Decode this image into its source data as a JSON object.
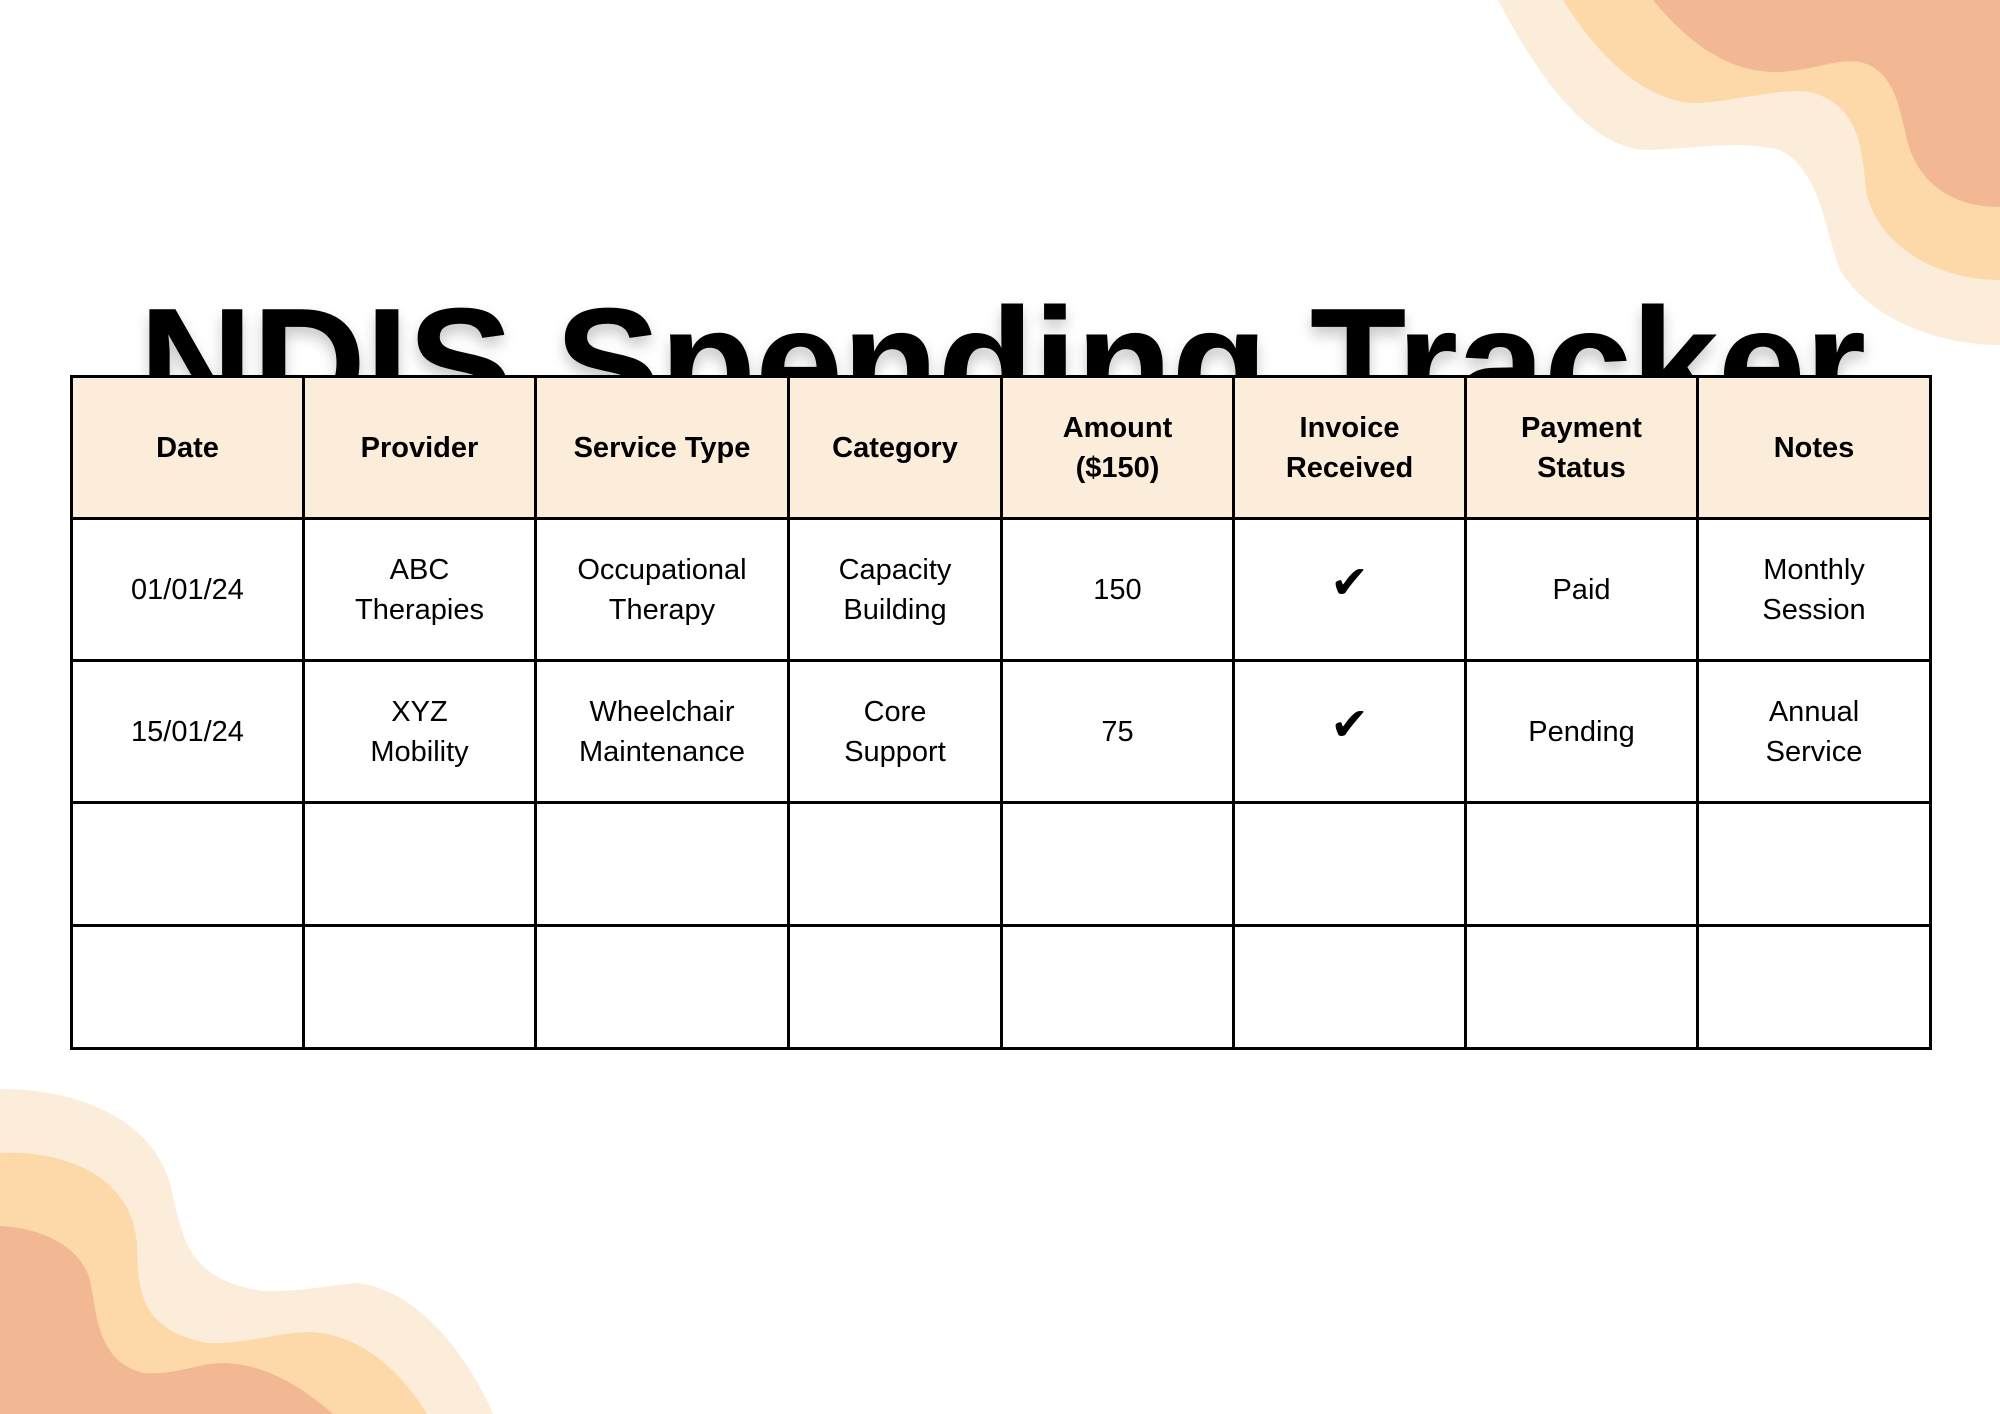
{
  "title": "NDIS Spending Tracker",
  "colors": {
    "header_bg": "#FCEDDB",
    "wave_light": "#FCEDDB",
    "wave_mid": "#FDD8A8",
    "wave_dark": "#F2B894",
    "border": "#000000"
  },
  "table": {
    "headers": [
      {
        "lines": [
          "Date"
        ]
      },
      {
        "lines": [
          "Provider"
        ]
      },
      {
        "lines": [
          "Service Type"
        ]
      },
      {
        "lines": [
          "Category"
        ]
      },
      {
        "lines": [
          "Amount",
          "($150)"
        ]
      },
      {
        "lines": [
          "Invoice",
          "Received"
        ]
      },
      {
        "lines": [
          "Payment",
          "Status"
        ]
      },
      {
        "lines": [
          "Notes"
        ]
      }
    ],
    "rows": [
      {
        "date": "01/01/24",
        "provider": [
          "ABC",
          "Therapies"
        ],
        "service_type": [
          "Occupational",
          "Therapy"
        ],
        "category": [
          "Capacity",
          "Building"
        ],
        "amount": "150",
        "invoice_received": "check-icon",
        "invoice_glyph": "✔",
        "payment_status": "Paid",
        "notes": [
          "Monthly",
          "Session"
        ]
      },
      {
        "date": "15/01/24",
        "provider": [
          "XYZ",
          "Mobility"
        ],
        "service_type": [
          "Wheelchair",
          "Maintenance"
        ],
        "category": [
          "Core",
          "Support"
        ],
        "amount": "75",
        "invoice_received": "check-icon",
        "invoice_glyph": "✔",
        "payment_status": "Pending",
        "notes": [
          "Annual",
          "Service"
        ]
      }
    ],
    "empty_rows": 2
  }
}
